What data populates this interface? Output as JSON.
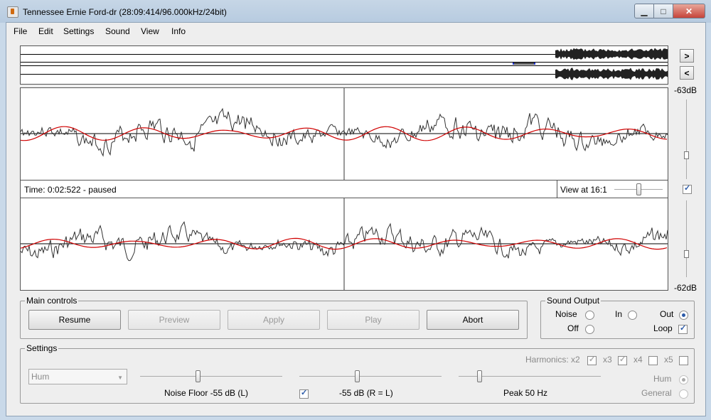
{
  "window": {
    "title": "Tennessee Ernie Ford-dr (28:09:414/96.000kHz/24bit)",
    "minimize_label": "▁",
    "maximize_label": "□",
    "close_label": "✕"
  },
  "menu": [
    "File",
    "Edit",
    "Settings",
    "Sound",
    "View",
    "Info"
  ],
  "overview": {
    "next_label": ">",
    "prev_label": "<"
  },
  "levels": {
    "top_db": "-63dB",
    "bottom_db": "-62dB"
  },
  "status": {
    "time_text": "Time: 0:02:522 - paused",
    "view_text": "View at 16:1",
    "sync_checked": true
  },
  "main_controls": {
    "title": "Main controls",
    "buttons": [
      "Resume",
      "Preview",
      "Apply",
      "Play",
      "Abort"
    ]
  },
  "sound_output": {
    "title": "Sound Output",
    "noise_label": "Noise",
    "off_label": "Off",
    "in_label": "In",
    "out_label": "Out",
    "loop_label": "Loop",
    "selected": "Out",
    "loop_checked": true
  },
  "settings": {
    "title": "Settings",
    "mode_value": "Hum",
    "harmonics_label": "Harmonics: x2",
    "x3_label": "x3",
    "x4_label": "x4",
    "x5_label": "x5",
    "noise_floor_label": "Noise Floor -55 dB (L)",
    "level_label": "-55 dB (R = L)",
    "level_checked": true,
    "peak_label": "Peak 50 Hz",
    "hum_label": "Hum",
    "general_label": "General"
  },
  "colors": {
    "waveform": "#333333",
    "filtered": "#d00000"
  }
}
